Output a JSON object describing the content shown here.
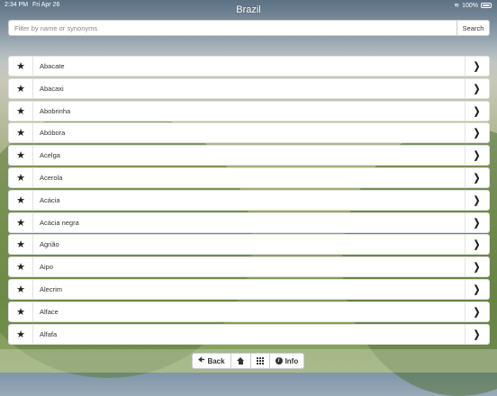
{
  "status_bar": {
    "time": "2:34 PM",
    "date": "Fri Apr 26",
    "battery": "100%"
  },
  "title": "Brazil",
  "search": {
    "placeholder": "Filter by name or synonyms",
    "button_label": "Search"
  },
  "items": [
    "Abacate",
    "Abacaxi",
    "Abobrinha",
    "Abóbora",
    "Acelga",
    "Acerola",
    "Acácia",
    "Acácia negra",
    "Agrião",
    "Aipo",
    "Alecrim",
    "Alface",
    "Alfafa"
  ],
  "toolbar": {
    "back_label": "Back",
    "info_label": "Info"
  },
  "icons": {
    "star": "star-icon",
    "chevron": "chevron-right-icon",
    "back": "arrow-left-icon",
    "home": "home-icon",
    "grid": "grid-icon",
    "info": "info-icon"
  }
}
